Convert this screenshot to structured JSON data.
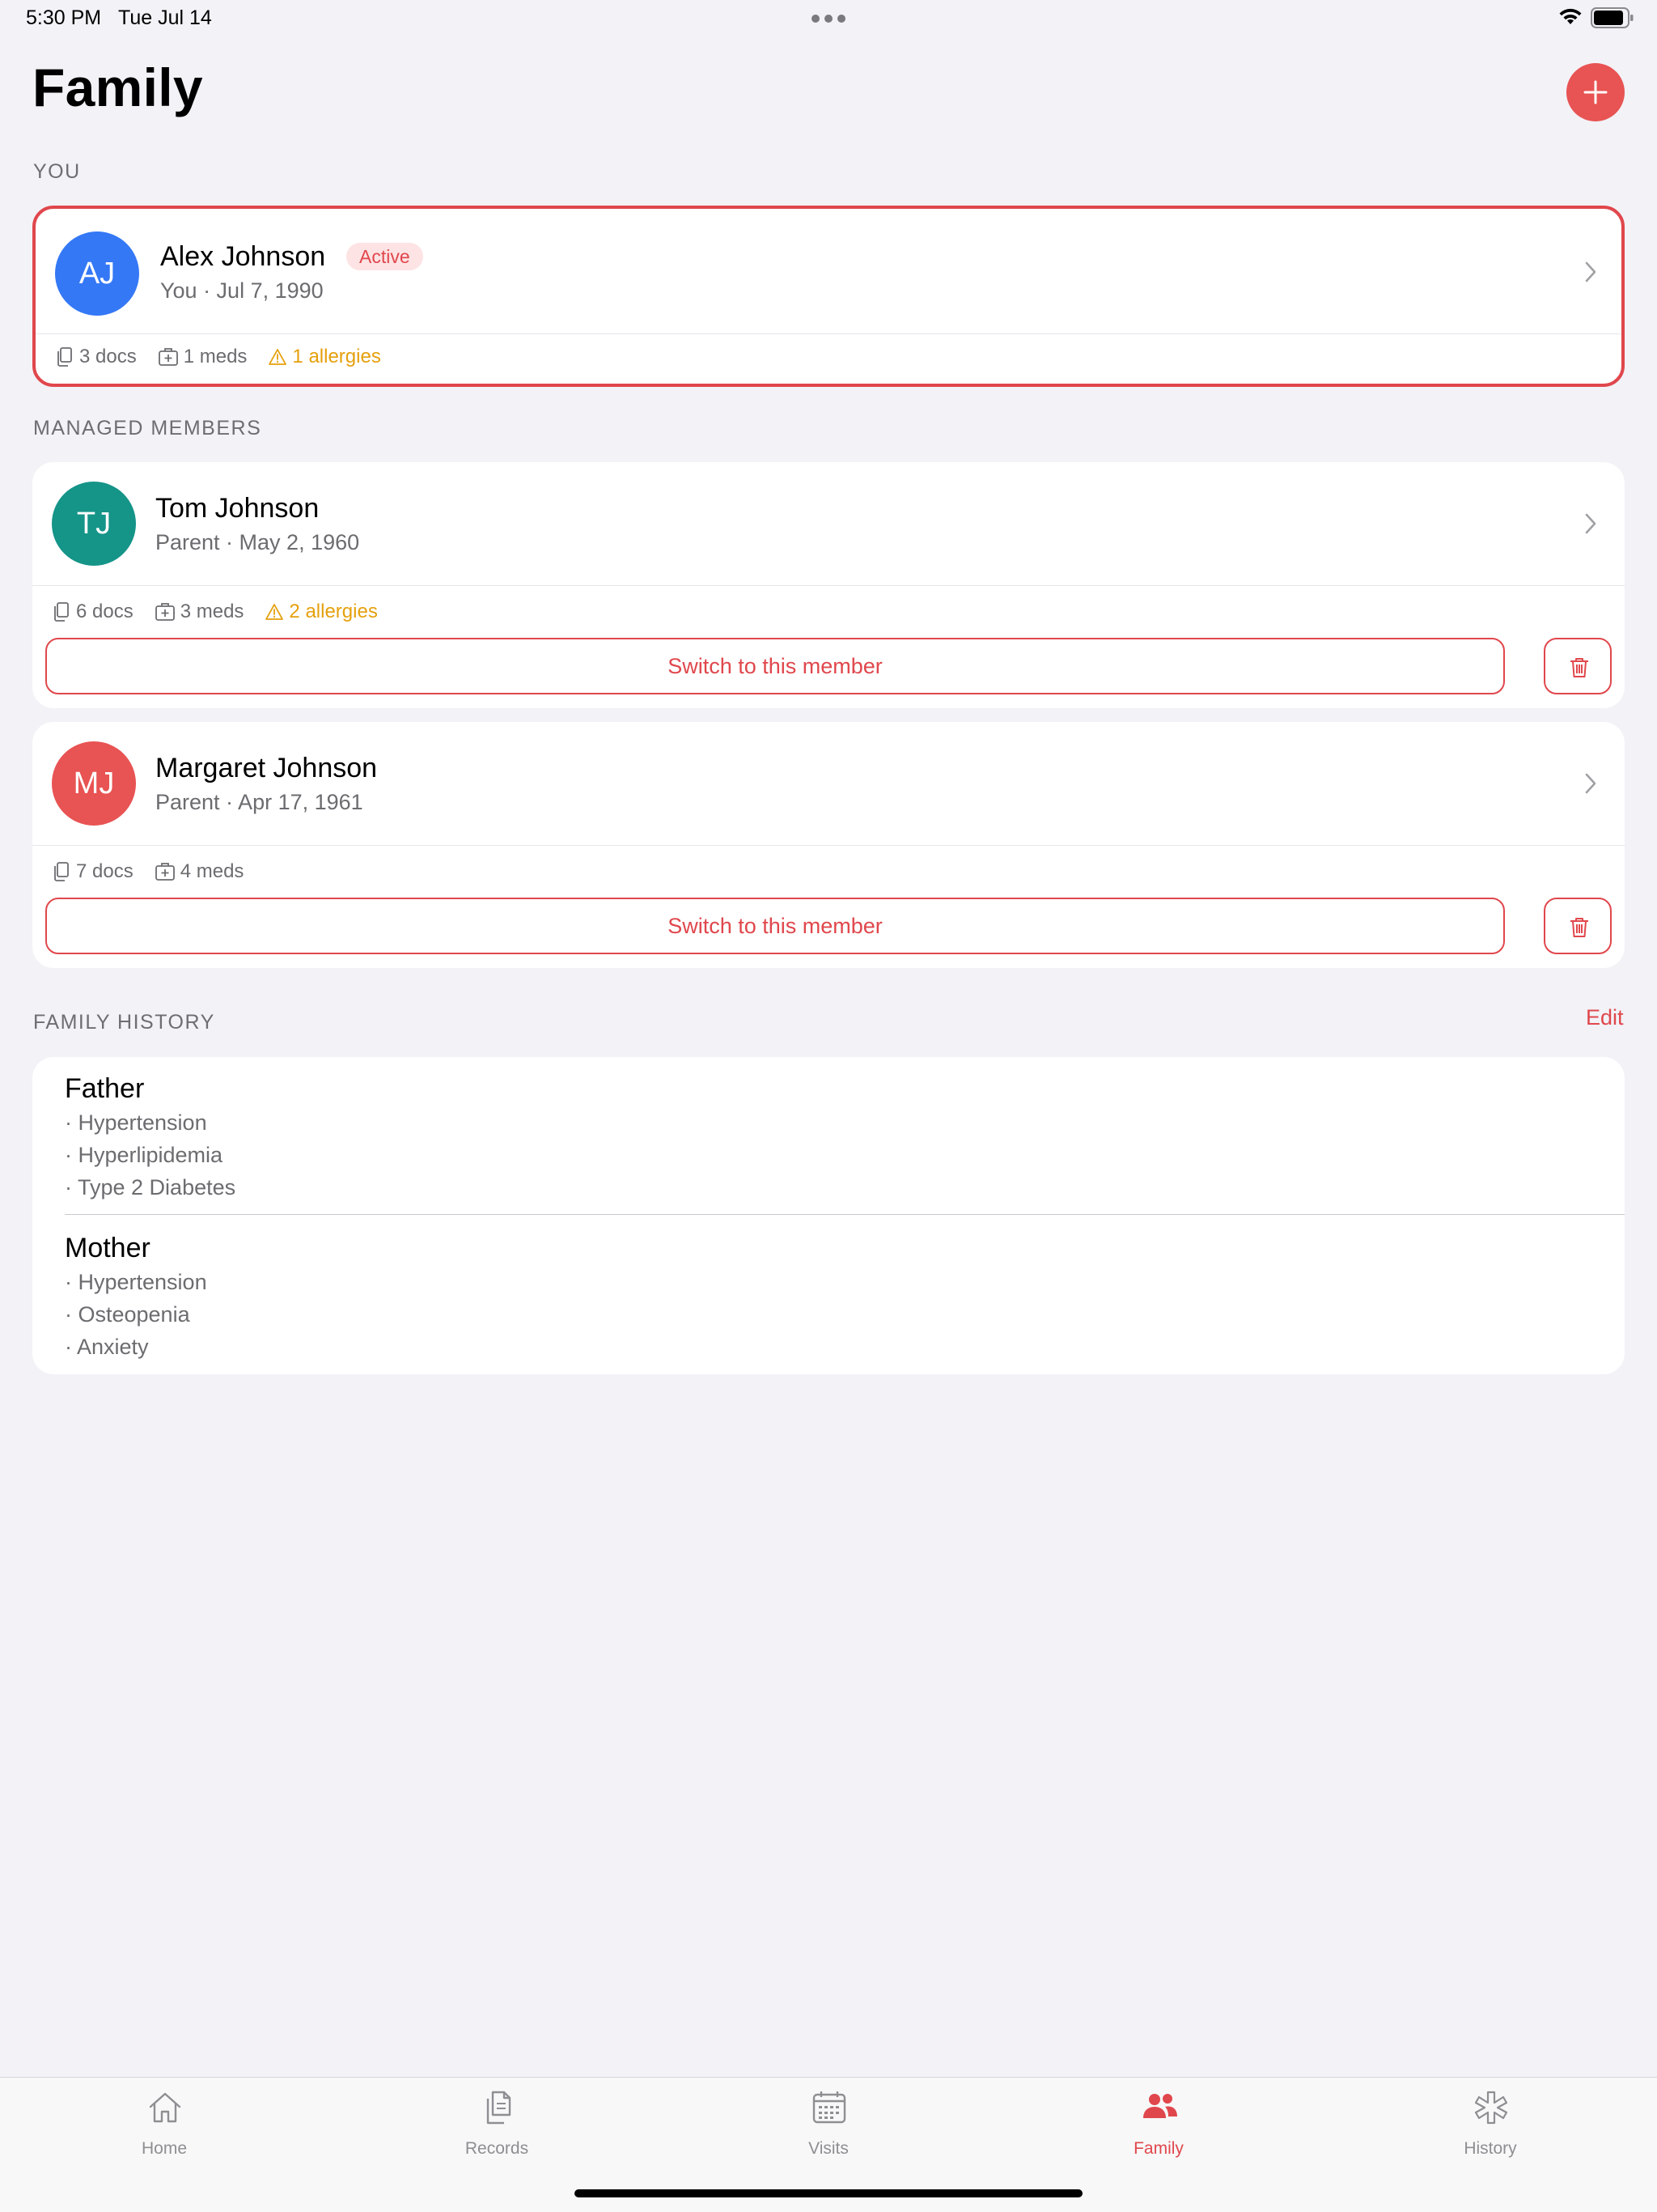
{
  "status_bar": {
    "time": "5:30 PM",
    "date": "Tue Jul 14"
  },
  "header": {
    "title": "Family",
    "add_icon": "plus-icon"
  },
  "sections": {
    "you": "YOU",
    "managed": "MANAGED MEMBERS",
    "history": "FAMILY HISTORY",
    "history_edit": "Edit"
  },
  "you_card": {
    "initials": "AJ",
    "name": "Alex Johnson",
    "badge": "Active",
    "subtitle": "You · Jul 7, 1990",
    "docs": "3 docs",
    "meds": "1 meds",
    "allergies": "1 allergies",
    "avatar_color": "#3478f6"
  },
  "members": [
    {
      "initials": "TJ",
      "name": "Tom Johnson",
      "subtitle": "Parent · May 2, 1960",
      "docs": "6 docs",
      "meds": "3 meds",
      "allergies": "2 allergies",
      "switch_label": "Switch to this member",
      "avatar_color": "#159488"
    },
    {
      "initials": "MJ",
      "name": "Margaret Johnson",
      "subtitle": "Parent · Apr 17, 1961",
      "docs": "7 docs",
      "meds": "4 meds",
      "switch_label": "Switch to this member",
      "avatar_color": "#e85353"
    }
  ],
  "family_history": [
    {
      "relation": "Father",
      "conditions": [
        "· Hypertension",
        "· Hyperlipidemia",
        "· Type 2 Diabetes"
      ]
    },
    {
      "relation": "Mother",
      "conditions": [
        "· Hypertension",
        "· Osteopenia",
        "· Anxiety"
      ]
    }
  ],
  "tabs": [
    {
      "label": "Home",
      "icon": "house-icon"
    },
    {
      "label": "Records",
      "icon": "documents-icon"
    },
    {
      "label": "Visits",
      "icon": "calendar-icon"
    },
    {
      "label": "Family",
      "icon": "people-icon",
      "selected": true
    },
    {
      "label": "History",
      "icon": "asterisk-icon"
    }
  ],
  "colors": {
    "accent": "#e0474c",
    "warning": "#e5a00d",
    "background": "#f2f2f7"
  }
}
